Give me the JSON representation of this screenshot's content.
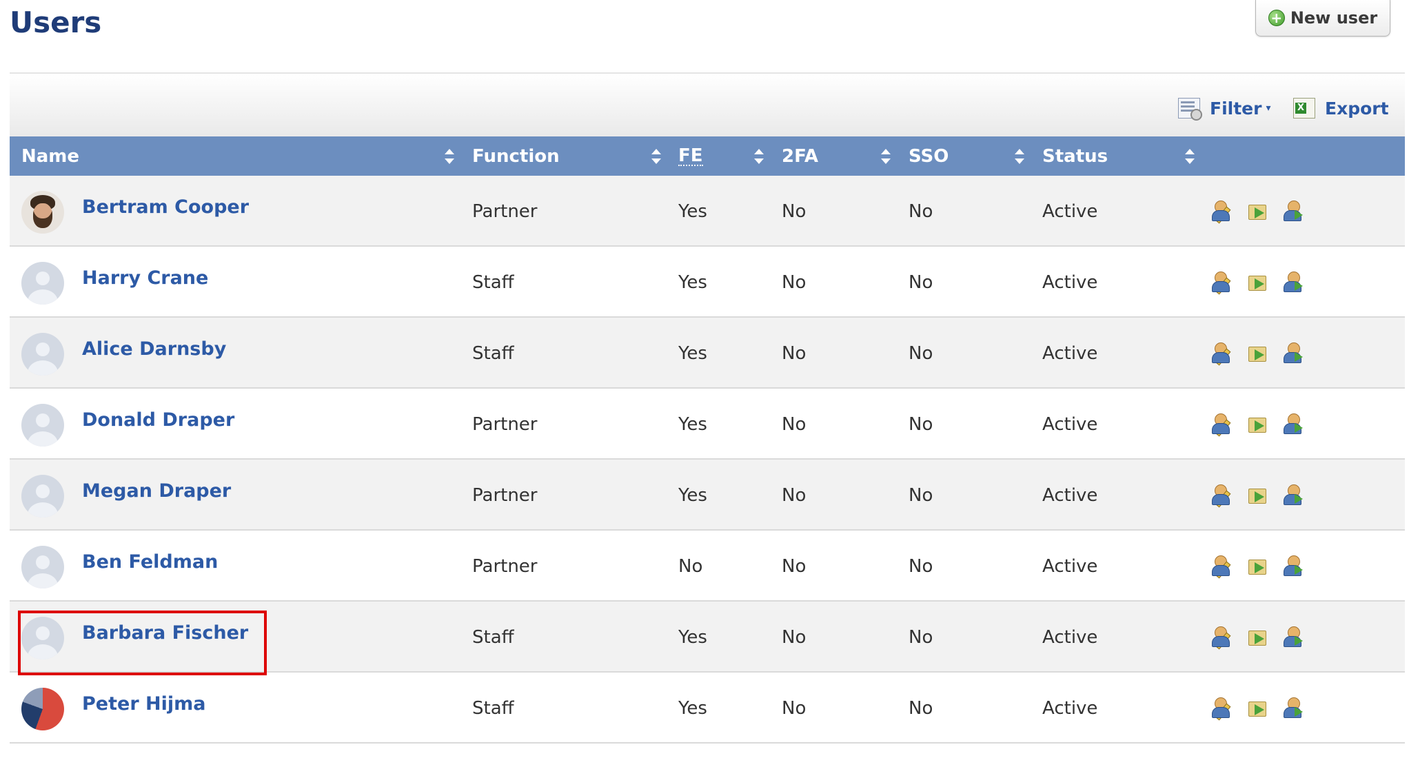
{
  "header": {
    "title": "Users",
    "new_user_label": "New user"
  },
  "toolbar": {
    "filter_label": "Filter",
    "export_label": "Export"
  },
  "table": {
    "columns": {
      "name": "Name",
      "function": "Function",
      "fe": "FE",
      "twofa": "2FA",
      "sso": "SSO",
      "status": "Status"
    },
    "rows": [
      {
        "name": "Bertram Cooper",
        "function": "Partner",
        "fe": "Yes",
        "twofa": "No",
        "sso": "No",
        "status": "Active",
        "avatar": "photo"
      },
      {
        "name": "Harry Crane",
        "function": "Staff",
        "fe": "Yes",
        "twofa": "No",
        "sso": "No",
        "status": "Active",
        "avatar": "placeholder"
      },
      {
        "name": "Alice Darnsby",
        "function": "Staff",
        "fe": "Yes",
        "twofa": "No",
        "sso": "No",
        "status": "Active",
        "avatar": "placeholder"
      },
      {
        "name": "Donald Draper",
        "function": "Partner",
        "fe": "Yes",
        "twofa": "No",
        "sso": "No",
        "status": "Active",
        "avatar": "placeholder"
      },
      {
        "name": "Megan Draper",
        "function": "Partner",
        "fe": "Yes",
        "twofa": "No",
        "sso": "No",
        "status": "Active",
        "avatar": "placeholder"
      },
      {
        "name": "Ben Feldman",
        "function": "Partner",
        "fe": "No",
        "twofa": "No",
        "sso": "No",
        "status": "Active",
        "avatar": "placeholder"
      },
      {
        "name": "Barbara Fischer",
        "function": "Staff",
        "fe": "Yes",
        "twofa": "No",
        "sso": "No",
        "status": "Active",
        "avatar": "placeholder"
      },
      {
        "name": "Peter Hijma",
        "function": "Staff",
        "fe": "Yes",
        "twofa": "No",
        "sso": "No",
        "status": "Active",
        "avatar": "logo"
      }
    ]
  },
  "colors": {
    "header_bg": "#6c8ebf",
    "link": "#2d5aa6",
    "title": "#1f3c78",
    "highlight": "#dd0000"
  }
}
